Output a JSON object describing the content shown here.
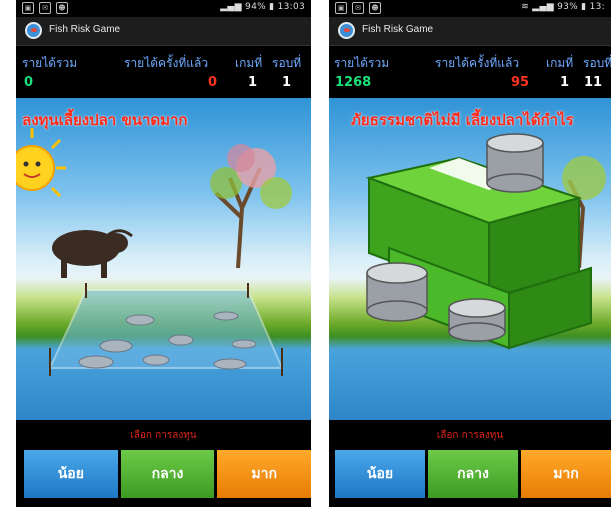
{
  "left": {
    "status_time": "13:03",
    "status_battery": "94%",
    "app_title": "Fish Risk Game",
    "labels": {
      "total_income": "รายได้รวม",
      "last_income": "รายได้ครั้งที่แล้ว",
      "game": "เกมที่",
      "round": "รอบที่"
    },
    "values": {
      "total_income": "0",
      "last_income": "0",
      "game": "1",
      "round": "1"
    },
    "banner": "ลงทุนเลี้ยงปลา ขนาดมาก",
    "choose_prompt": "เลือก การลงทุน",
    "buttons": {
      "small": "น้อย",
      "medium": "กลาง",
      "large": "มาก"
    }
  },
  "right": {
    "status_time": "13:",
    "status_battery": "93%",
    "app_title": "Fish Risk Game",
    "labels": {
      "total_income": "รายได้รวม",
      "last_income": "รายได้ครั้งที่แล้ว",
      "game": "เกมที่",
      "round": "รอบที่"
    },
    "values": {
      "total_income": "1268",
      "last_income": "95",
      "game": "1",
      "round": "11"
    },
    "banner": "ภัยธรรมชาติไม่มี เลี้ยงปลาได้กำไร",
    "choose_prompt": "เลือก การลงทุน",
    "buttons": {
      "small": "น้อย",
      "medium": "กลาง",
      "large": "มาก"
    }
  },
  "colors": {
    "label_blue": "#6fa9ff",
    "total_green": "#19e07a",
    "last_red": "#ff3322",
    "banner_red": "#ff2a1a",
    "button_small": "#2a86d2",
    "button_medium": "#4fb32f",
    "button_large": "#f08a10"
  },
  "icons": [
    "notification-icon",
    "wifi-icon",
    "signal-icon",
    "battery-icon",
    "app-logo-icon"
  ]
}
